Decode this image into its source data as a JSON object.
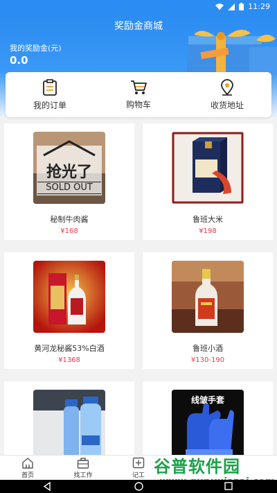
{
  "status_bar": {
    "time": "11:29"
  },
  "header": {
    "title": "奖励金商城",
    "balance_label": "我的奖励金(元)",
    "balance_value": "0.0"
  },
  "quick_actions": [
    {
      "label": "我的订单",
      "icon": "clipboard-icon"
    },
    {
      "label": "购物车",
      "icon": "cart-icon"
    },
    {
      "label": "收货地址",
      "icon": "location-pin-icon"
    }
  ],
  "products": [
    {
      "name": "秘制牛肉酱",
      "price": "¥168",
      "badge_cn": "抢光了",
      "badge_en": "SOLD OUT"
    },
    {
      "name": "鲁班大米",
      "price": "¥198"
    },
    {
      "name": "黄河龙秘酱53%白酒",
      "price": "¥1368"
    },
    {
      "name": "鲁班小酒",
      "price": "¥130-190"
    },
    {
      "name": "",
      "price": ""
    },
    {
      "name": "",
      "price": "",
      "image_text": "线皱手套"
    }
  ],
  "tabbar": [
    {
      "label": "首页",
      "icon": "home-icon"
    },
    {
      "label": "找工作",
      "icon": "briefcase-icon"
    },
    {
      "label": "记工",
      "icon": "plus-square-icon"
    }
  ],
  "watermark": {
    "line1": "谷普软件园",
    "line2": "www.gupuxiazai.com"
  },
  "colors": {
    "primary": "#2b8cf2",
    "price": "#e5394a",
    "watermark": "#1aa24a"
  }
}
